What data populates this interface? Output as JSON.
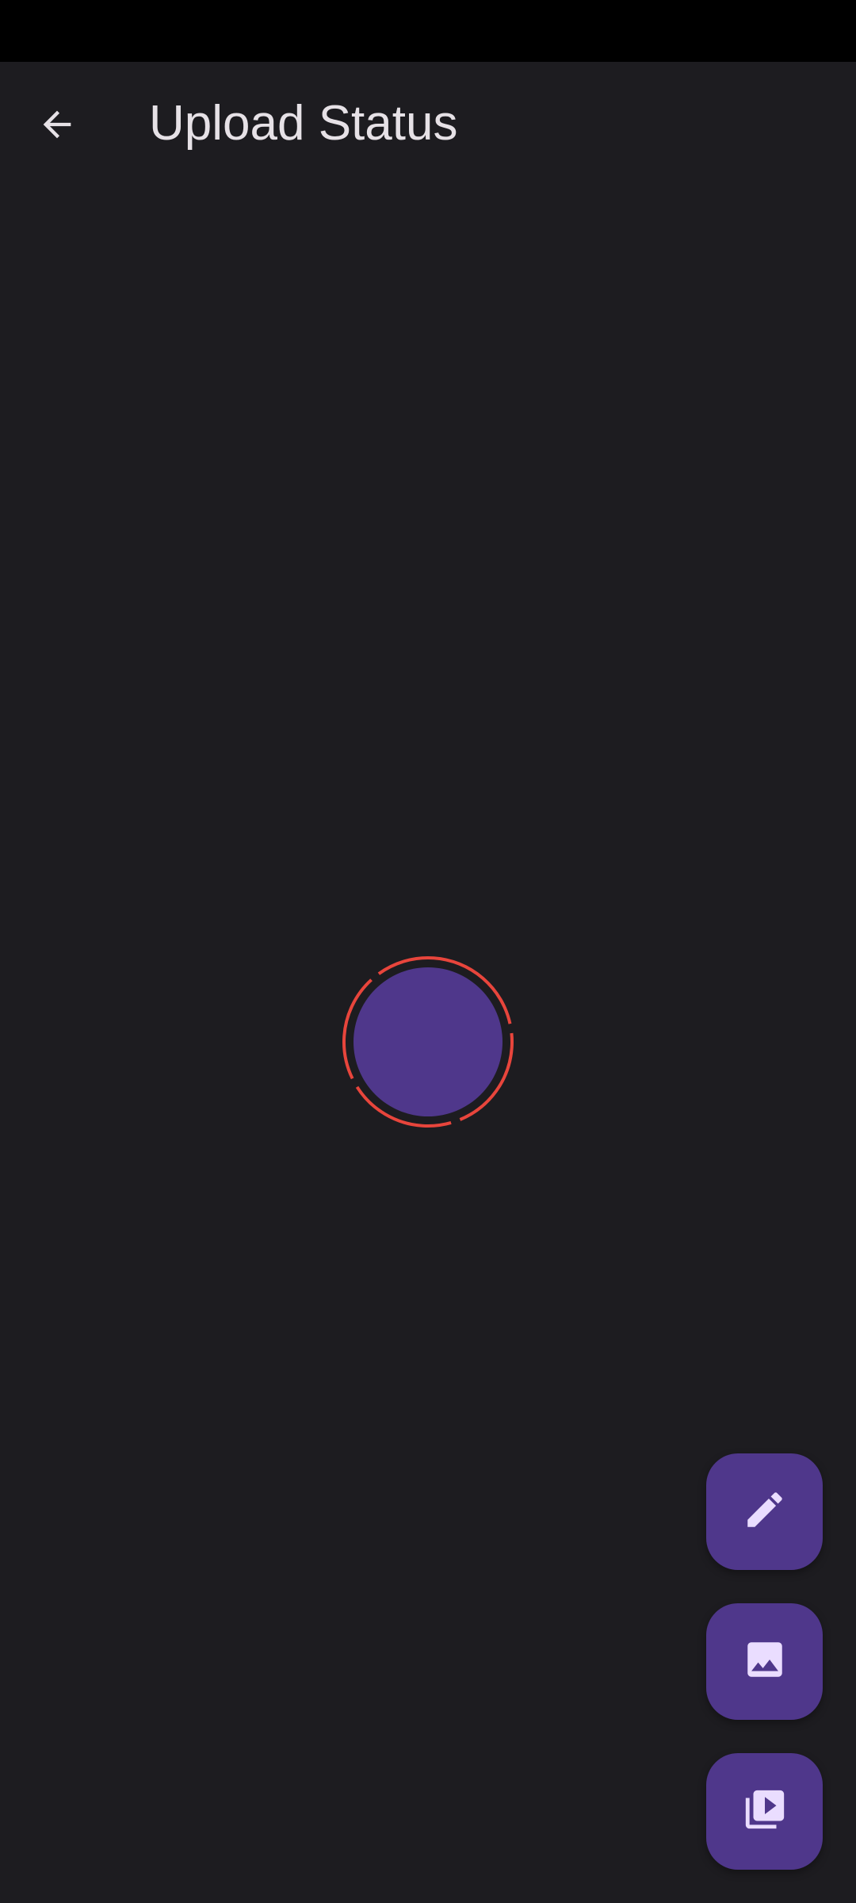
{
  "status_bar": {},
  "app_bar": {
    "title": "Upload Status",
    "back_icon": "arrow-back-icon"
  },
  "avatar": {
    "fill_color": "#4f378b",
    "ring_color": "#e8453c",
    "ring_style": "segmented-circle"
  },
  "fabs": [
    {
      "name": "edit-text-status",
      "icon": "pencil-icon"
    },
    {
      "name": "image-status",
      "icon": "image-icon"
    },
    {
      "name": "video-status",
      "icon": "video-library-icon"
    }
  ],
  "colors": {
    "background": "#1d1c20",
    "status_bar": "#000000",
    "title_text": "#e6e1e6",
    "fab_container": "#4f378b",
    "fab_icon": "#eaddff"
  }
}
